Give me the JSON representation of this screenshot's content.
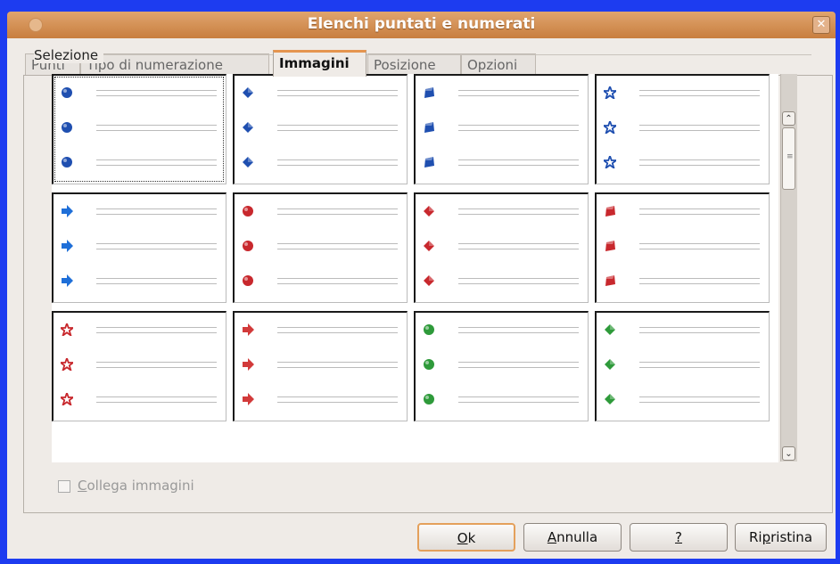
{
  "window": {
    "title": "Elenchi puntati e numerati"
  },
  "tabs": [
    {
      "label": "Punti"
    },
    {
      "label": "Tipo di numerazione"
    },
    {
      "label": "Immagini"
    },
    {
      "label": "Posizione"
    },
    {
      "label": "Opzioni"
    }
  ],
  "active_tab": "Immagini",
  "selection": {
    "label": "Selezione",
    "bullets": [
      {
        "shape": "sphere",
        "color": "#1f4fb0"
      },
      {
        "shape": "arrow-diamond",
        "color": "#1f4fb0"
      },
      {
        "shape": "cube",
        "color": "#1f4fb0"
      },
      {
        "shape": "star",
        "color": "#1f4fb0"
      },
      {
        "shape": "arrow-right",
        "color": "#1f6fd8"
      },
      {
        "shape": "sphere",
        "color": "#c8282d"
      },
      {
        "shape": "arrow-diamond",
        "color": "#c8282d"
      },
      {
        "shape": "cube",
        "color": "#c8282d"
      },
      {
        "shape": "star",
        "color": "#c8282d"
      },
      {
        "shape": "arrow-right",
        "color": "#d23a3a"
      },
      {
        "shape": "sphere",
        "color": "#2e9a3a"
      },
      {
        "shape": "arrow-diamond",
        "color": "#2e9a3a"
      }
    ]
  },
  "link_images": {
    "label": "Collega immagini",
    "accel": "C",
    "rest": "ollega immagini",
    "checked": false
  },
  "buttons": {
    "ok": {
      "accel": "O",
      "rest": "k"
    },
    "cancel": {
      "accel": "A",
      "rest": "nnulla"
    },
    "help": {
      "label": "?"
    },
    "reset": {
      "pre": "Ri",
      "accel": "p",
      "rest": "ristina"
    }
  }
}
